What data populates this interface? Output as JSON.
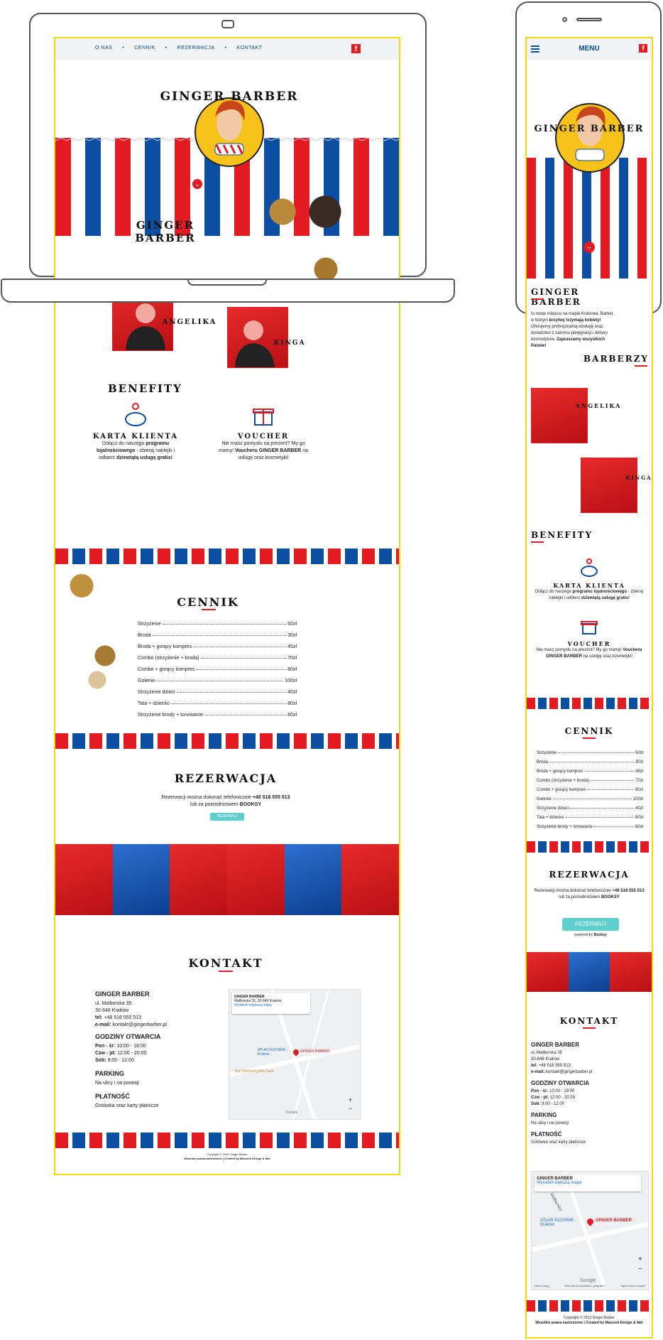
{
  "nav": {
    "items": [
      "O NAS",
      "CENNIK",
      "REZERWACJA",
      "KONTAKT"
    ],
    "menu_label": "MENU",
    "facebook_icon": "facebook-icon"
  },
  "hero": {
    "logo_text": "GINGER BARBER",
    "scroll_icon": "chevron-down-icon"
  },
  "about": {
    "title": "GINGER BARBER",
    "text_prefix": "to nowe miejsce na mapie Krakowa. Barber, w którym ",
    "text_bold1": "brzytwy trzymają kobiety!",
    "text_mid": " Oferujemy profesjonalną obsługę oraz doradztwo z zakresu pielęgnacji i dobory kosmetyków. ",
    "text_bold2": "Zapraszamy wszystkich Panów!"
  },
  "barbers": {
    "title": "BARBERZY",
    "people": [
      "ANGELIKA",
      "KINGA"
    ]
  },
  "benefits": {
    "title": "BENEFITY",
    "card": {
      "icon": "piggy-bank-icon",
      "title": "KARTA KLIENTA",
      "t1": "Dołącz do naszego ",
      "b1": "programu lojalnościowego",
      "t2": " - zbieraj naklejki i odbierz ",
      "b2": "dziewiątą usługę gratis!"
    },
    "voucher": {
      "icon": "gift-icon",
      "title": "VOUCHER",
      "t1": "Nie masz pomysłu na prezent? My go mamy! ",
      "b1": "Voucheru GINGER BARBER",
      "t2": " na usługę oraz kosmetyki!"
    }
  },
  "pricing": {
    "title": "CENNIK",
    "items": [
      {
        "name": "Strzyżenie",
        "price": "50zł"
      },
      {
        "name": "Broda",
        "price": "30zł"
      },
      {
        "name": "Broda + gorący kompres",
        "price": "45zł"
      },
      {
        "name": "Combo (strzyżenie + broda)",
        "price": "70zł"
      },
      {
        "name": "Combo + gorący kompres",
        "price": "80zł"
      },
      {
        "name": "Golenie",
        "price": "100zł"
      },
      {
        "name": "Strzyżenie dzieci",
        "price": "40zł"
      },
      {
        "name": "Tata + dziecko",
        "price": "80zł"
      },
      {
        "name": "Strzyżenie brody + tonowanie",
        "price": "60zł"
      }
    ]
  },
  "reservation": {
    "title": "REZERWACJA",
    "text1": "Rezerwacji można dokonać telefonicznie ",
    "phone": "+48 518 555 513",
    "text2": "lub za pośrednictwem ",
    "booksy": "BOOKSY",
    "button": "REZERWUJ",
    "powered": "powered by",
    "powered_brand": "Booksy"
  },
  "contact": {
    "title": "KONTAKT",
    "name": "GINGER BARBER",
    "street": "ul. Malborska 35",
    "city": "30-646 Kraków",
    "tel_label": "tel:",
    "tel": "+48 518 555 513",
    "email_label": "e-mail:",
    "email": "kontakt@gingerbarber.pl",
    "hours_title": "GODZINY OTWARCIA",
    "hours": [
      {
        "days": "Pon - śr:",
        "time": "10:00 - 18:00"
      },
      {
        "days": "Czw - pt:",
        "time": "12:00 - 20:00"
      },
      {
        "days": "Sob:",
        "time": "9:00 - 12:00"
      }
    ],
    "parking_title": "PARKING",
    "parking_text": "Na ulicy i na posesji",
    "payment_title": "PŁATNOŚĆ",
    "payment_text": "Gotówka oraz karty płatnicze"
  },
  "map": {
    "place": "GINGER BARBER",
    "address": "Malborska 35, 30-646 Kraków",
    "link": "Wyświetl większą mapę",
    "street_label": "Malborska",
    "poi1": "ATLAS KUCHNIE - Kraków",
    "poi2": "Bar Orientalny Anh Tuan",
    "pin_label": "GINGER BARBER",
    "zoom_in": "+",
    "zoom_out": "−",
    "google": "Google",
    "footer_links": [
      "Dane mapy",
      "Warunki korzystania z programu",
      "Zgłoś błąd w mapie"
    ]
  },
  "footer": {
    "line1": "Copyright © 2019 Ginger Barber",
    "line2": "Wszelkie prawa zastrzeżone | Created by Mazurek Design & fabi"
  },
  "colors": {
    "red": "#e31b23",
    "blue": "#0b4ea2",
    "yellow_frame": "#f5d90a",
    "teal_button": "#5ecfcc"
  }
}
